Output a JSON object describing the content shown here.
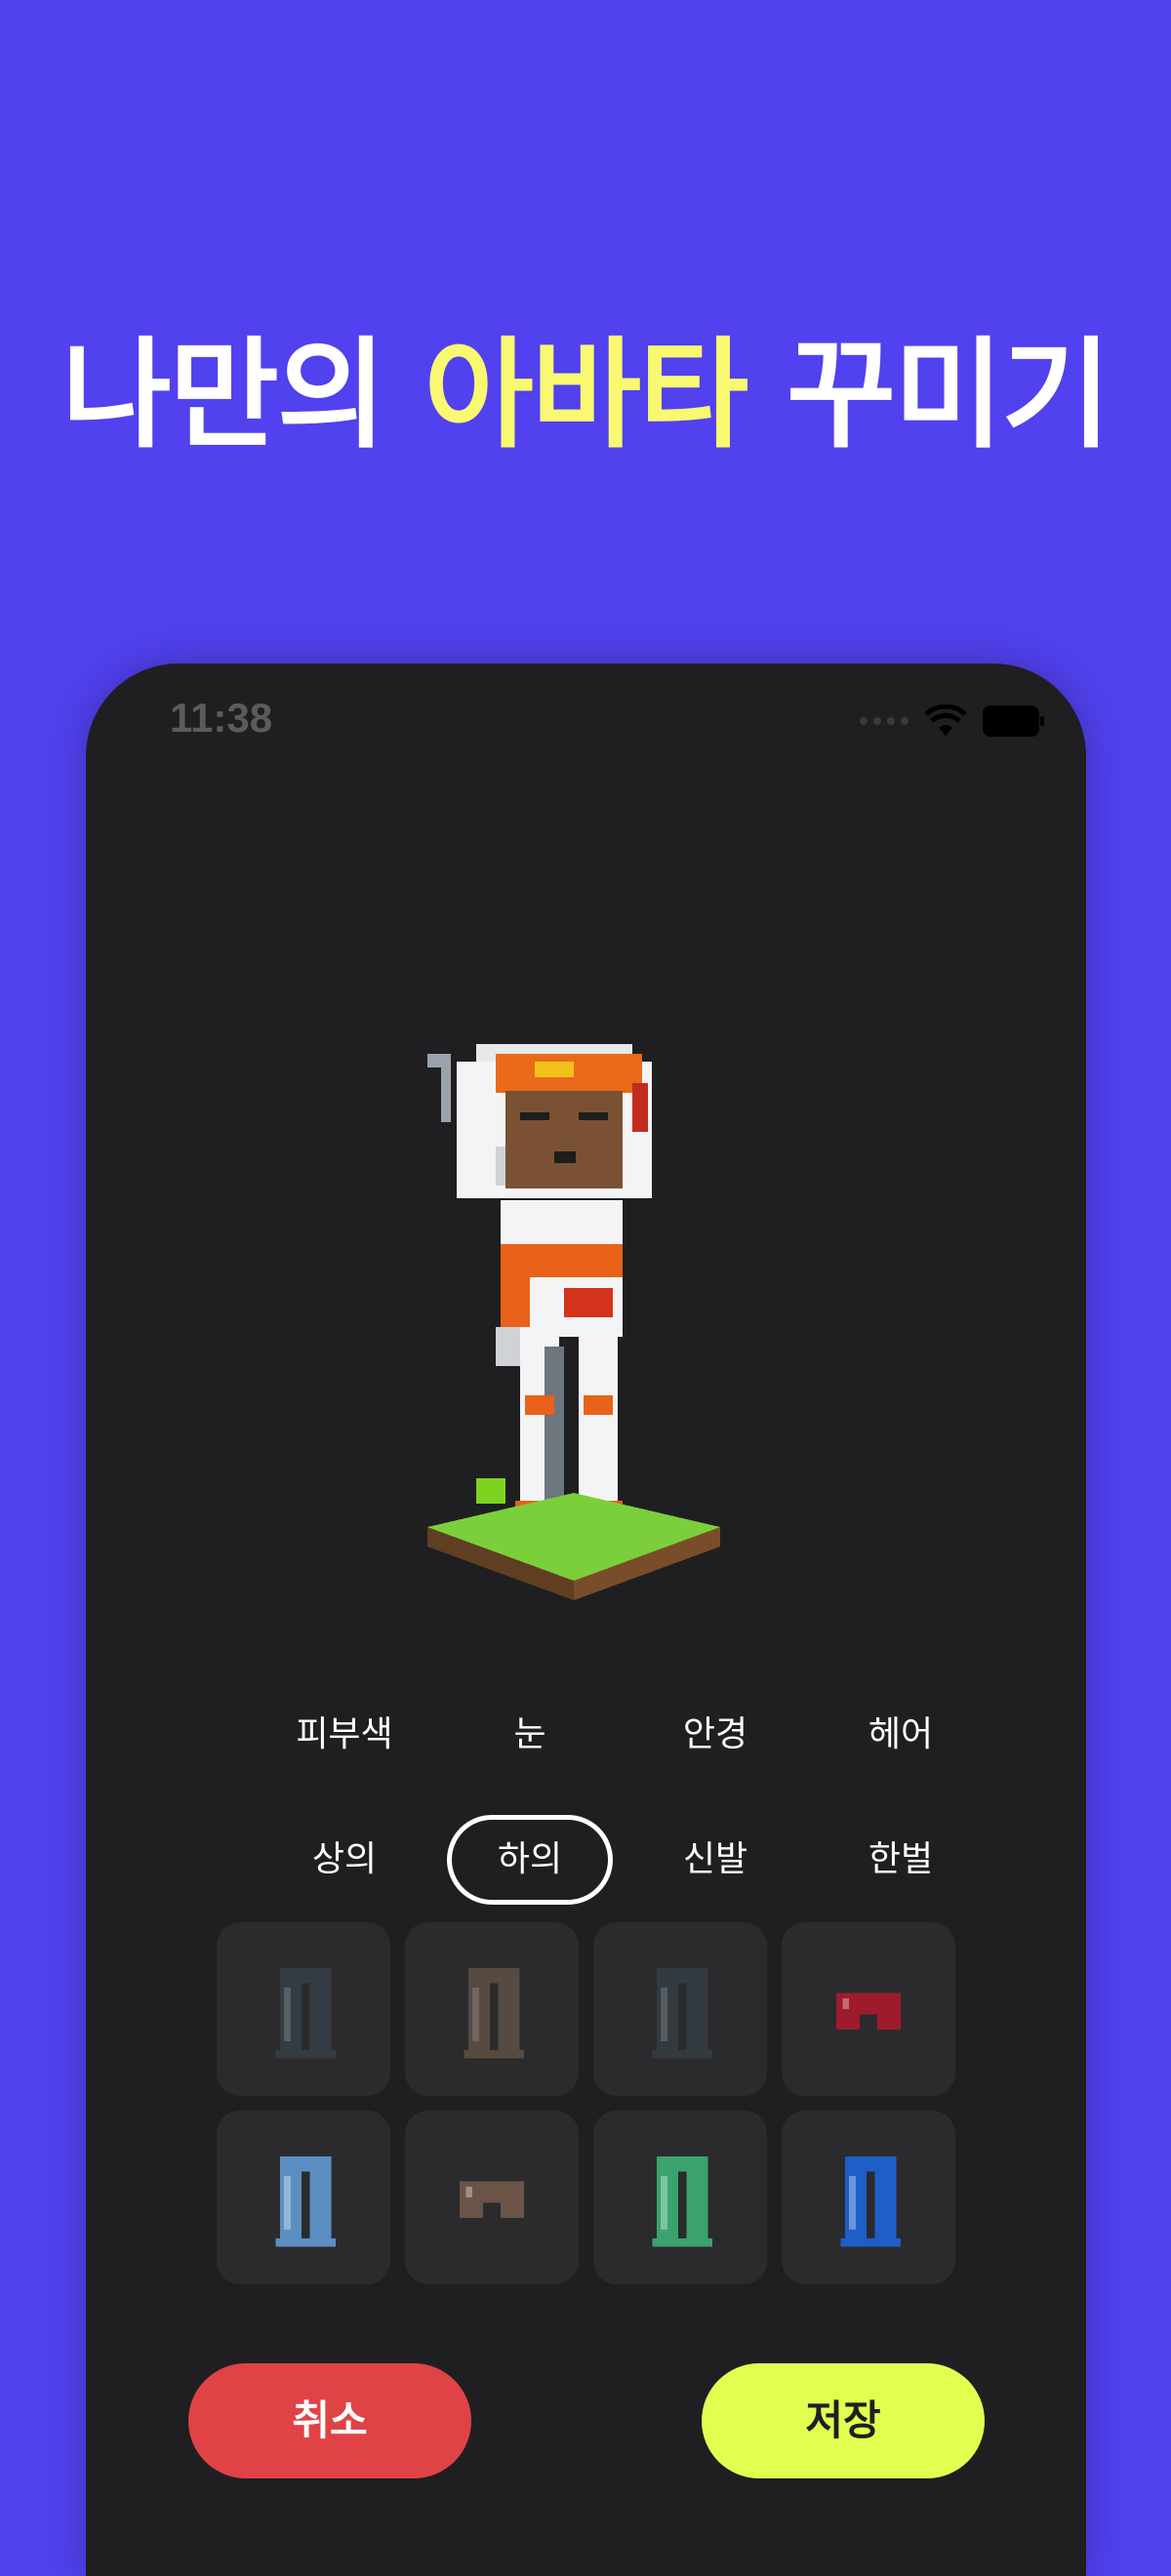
{
  "headline": {
    "before": "나만의 ",
    "accent": "아바타",
    "after": " 꾸미기"
  },
  "colors": {
    "background": "#5141ee",
    "accent": "#f9f871",
    "phone": "#1f1f21",
    "cancel": "#e04346",
    "save": "#e2ff50"
  },
  "status_bar": {
    "time": "11:38",
    "icons": [
      "signal-dots-icon",
      "wifi-icon",
      "battery-icon"
    ]
  },
  "categories_row1": [
    {
      "label": "피부색"
    },
    {
      "label": "눈"
    },
    {
      "label": "안경"
    },
    {
      "label": "헤어"
    }
  ],
  "categories_row2": [
    {
      "label": "상의"
    },
    {
      "label": "하의",
      "selected": true
    },
    {
      "label": "신발"
    },
    {
      "label": "한벌"
    }
  ],
  "items": [
    {
      "icon": "pants-dark-gray-icon",
      "color": "#3d4a55",
      "dimmed": true
    },
    {
      "icon": "pants-tan-icon",
      "color": "#7a6552",
      "dimmed": true
    },
    {
      "icon": "pants-slate-icon",
      "color": "#3a4750",
      "dimmed": true
    },
    {
      "icon": "shorts-red-icon",
      "color": "#9e1b2c",
      "dimmed": false
    },
    {
      "icon": "pants-light-blue-icon",
      "color": "#5b8fc2",
      "dimmed": false
    },
    {
      "icon": "shorts-brown-icon",
      "color": "#6a5448",
      "dimmed": false
    },
    {
      "icon": "pants-green-icon",
      "color": "#3aa36d",
      "dimmed": false
    },
    {
      "icon": "pants-blue-icon",
      "color": "#1d5fc7",
      "dimmed": false
    }
  ],
  "buttons": {
    "cancel": "취소",
    "save": "저장"
  }
}
